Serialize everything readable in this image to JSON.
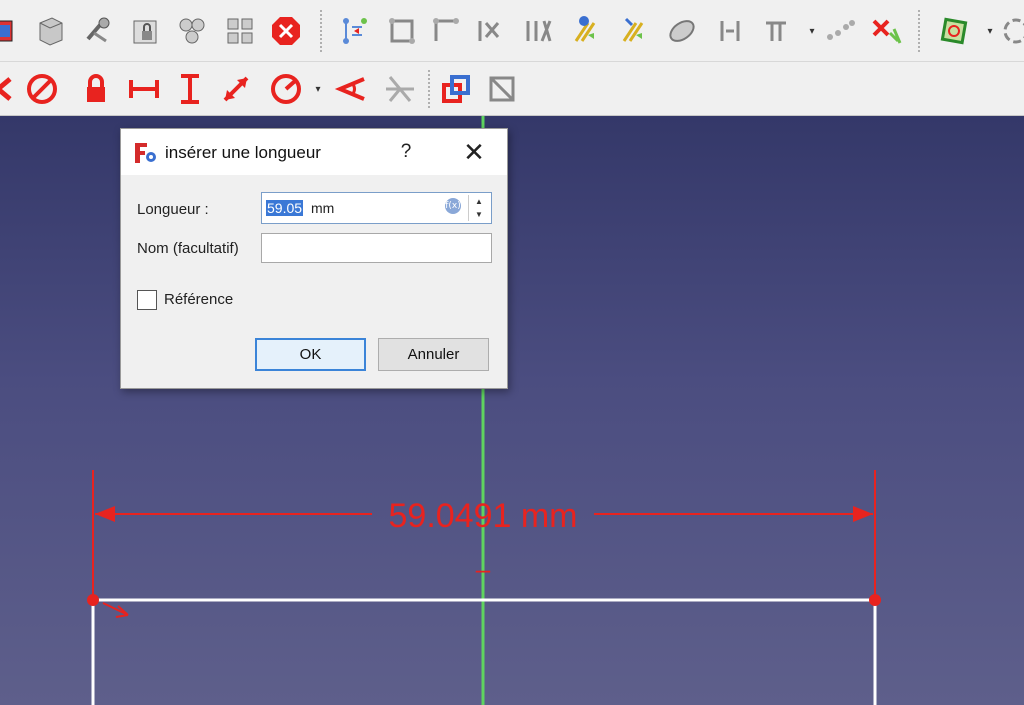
{
  "dialog": {
    "title": "insérer une longueur",
    "help_symbol": "?",
    "close_symbol": "✕",
    "length_label": "Longueur :",
    "length_value": "59.05",
    "length_unit": "mm",
    "name_label": "Nom (facultatif)",
    "name_value": "",
    "reference_label": "Référence",
    "reference_checked": false,
    "ok_label": "OK",
    "cancel_label": "Annuler"
  },
  "sketch": {
    "dimension_label": "59.0491 mm",
    "constraint_mark": "–"
  },
  "colors": {
    "constraint_red": "#e8231f",
    "axis_green": "#5fd45f",
    "geometry_white": "#ffffff",
    "selection_blue": "#3a78d6"
  },
  "toolbar_row1": [
    "link-part-icon",
    "box-icon",
    "tools-icon",
    "lock-part-icon",
    "component-icon",
    "assembly-icon",
    "stop-icon",
    "constraint-tools-icon-1",
    "constraint-tools-icon-2",
    "constraint-tools-icon-3",
    "constraint-tools-icon-4",
    "constraint-tools-icon-5",
    "constraint-tools-icon-6",
    "constraint-tools-icon-7",
    "sketch-ellipse-icon",
    "constraint-tools-icon-8",
    "constraint-tools-icon-9",
    "constraint-tools-icon-10",
    "delete-constraints-icon",
    "sketch-view-icon"
  ],
  "toolbar_row2": [
    "arrow-left-icon",
    "block-constraint-icon",
    "lock-constraint-icon",
    "horizontal-distance-icon",
    "vertical-distance-icon",
    "distance-icon",
    "radius-icon",
    "angle-icon",
    "snell-law-icon",
    "toggle-construction-icon",
    "toggle-driving-icon"
  ]
}
